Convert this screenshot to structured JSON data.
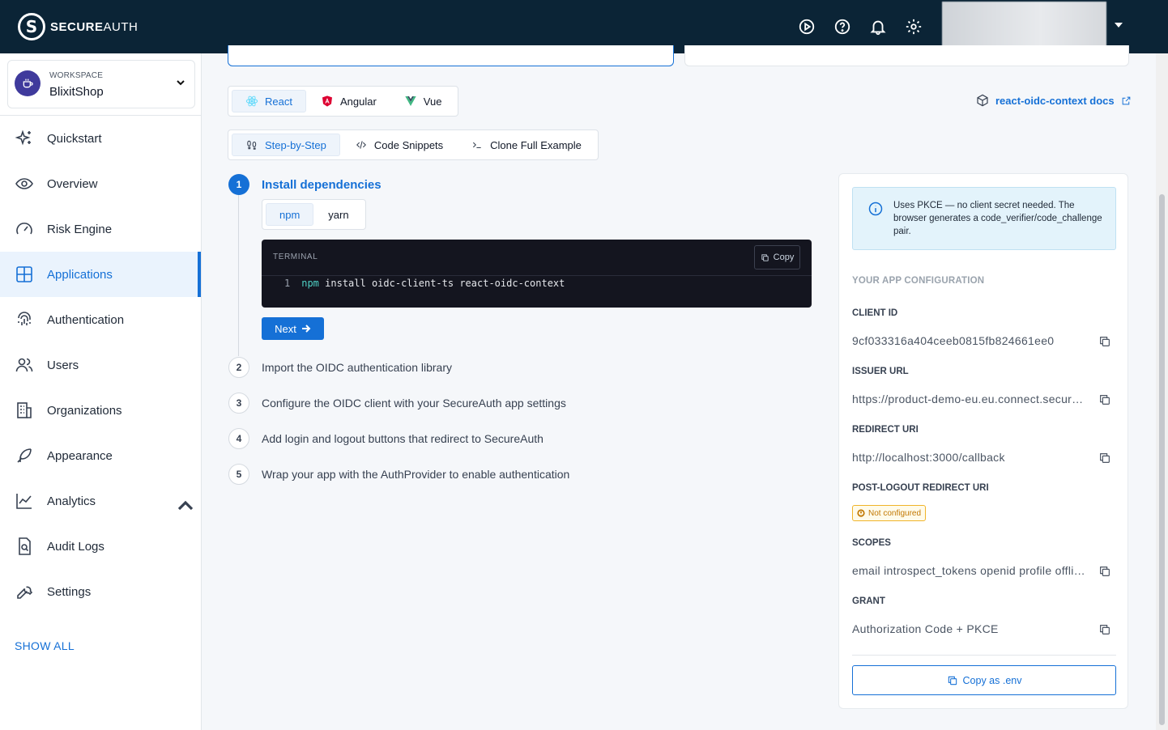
{
  "app": {
    "logo_strong": "SECURE",
    "logo_light": "AUTH"
  },
  "topbar": {
    "icons": [
      "play-circle-icon",
      "help-circle-icon",
      "bell-icon",
      "gear-icon"
    ]
  },
  "workspace": {
    "label": "WORKSPACE",
    "name": "BlixitShop"
  },
  "sidebar": {
    "items": [
      {
        "label": "Quickstart",
        "icon": "sparkle-icon"
      },
      {
        "label": "Overview",
        "icon": "eye-icon"
      },
      {
        "label": "Risk Engine",
        "icon": "gauge-icon"
      },
      {
        "label": "Applications",
        "icon": "grid-icon",
        "active": true
      },
      {
        "label": "Authentication",
        "icon": "fingerprint-icon"
      },
      {
        "label": "Users",
        "icon": "users-icon"
      },
      {
        "label": "Organizations",
        "icon": "building-icon"
      },
      {
        "label": "Appearance",
        "icon": "feather-icon"
      },
      {
        "label": "Analytics",
        "icon": "chart-line-icon"
      },
      {
        "label": "Audit Logs",
        "icon": "file-search-icon"
      },
      {
        "label": "Settings",
        "icon": "wrench-icon"
      }
    ],
    "show_all": "SHOW ALL"
  },
  "frameworks": {
    "react": "React",
    "angular": "Angular",
    "vue": "Vue"
  },
  "modes": {
    "step": "Step-by-Step",
    "snippets": "Code Snippets",
    "clone": "Clone Full Example"
  },
  "docs_link": "react-oidc-context docs",
  "steps": [
    {
      "num": "1",
      "title": "Install dependencies"
    },
    {
      "num": "2",
      "title": "Import the OIDC authentication library"
    },
    {
      "num": "3",
      "title": "Configure the OIDC client with your SecureAuth app settings"
    },
    {
      "num": "4",
      "title": "Add login and logout buttons that redirect to SecureAuth"
    },
    {
      "num": "5",
      "title": "Wrap your app with the AuthProvider to enable authentication"
    }
  ],
  "pkg": {
    "npm": "npm",
    "yarn": "yarn"
  },
  "terminal": {
    "label": "TERMINAL",
    "copy": "Copy",
    "line_no": "1",
    "cmd": "npm",
    "args": "install oidc-client-ts react-oidc-context"
  },
  "next": "Next",
  "panel": {
    "info": "Uses PKCE — no client secret needed. The browser generates a code_verifier/code_challenge pair.",
    "heading": "YOUR APP CONFIGURATION",
    "client_id_label": "CLIENT ID",
    "client_id": "9cf033316a404ceeb0815fb824661ee0",
    "issuer_label": "ISSUER URL",
    "issuer": "https://product-demo-eu.eu.connect.secureauth.com/",
    "redirect_label": "REDIRECT URI",
    "redirect": "http://localhost:3000/callback",
    "post_logout_label": "POST-LOGOUT REDIRECT URI",
    "post_logout_badge": "Not configured",
    "scopes_label": "SCOPES",
    "scopes": "email introspect_tokens openid profile offline_access",
    "grant_label": "GRANT",
    "grant": "Authorization Code + PKCE",
    "env_button": "Copy as .env"
  },
  "colors": {
    "primary": "#1570d6",
    "topbar": "#0b2436",
    "warning": "#c27803"
  }
}
